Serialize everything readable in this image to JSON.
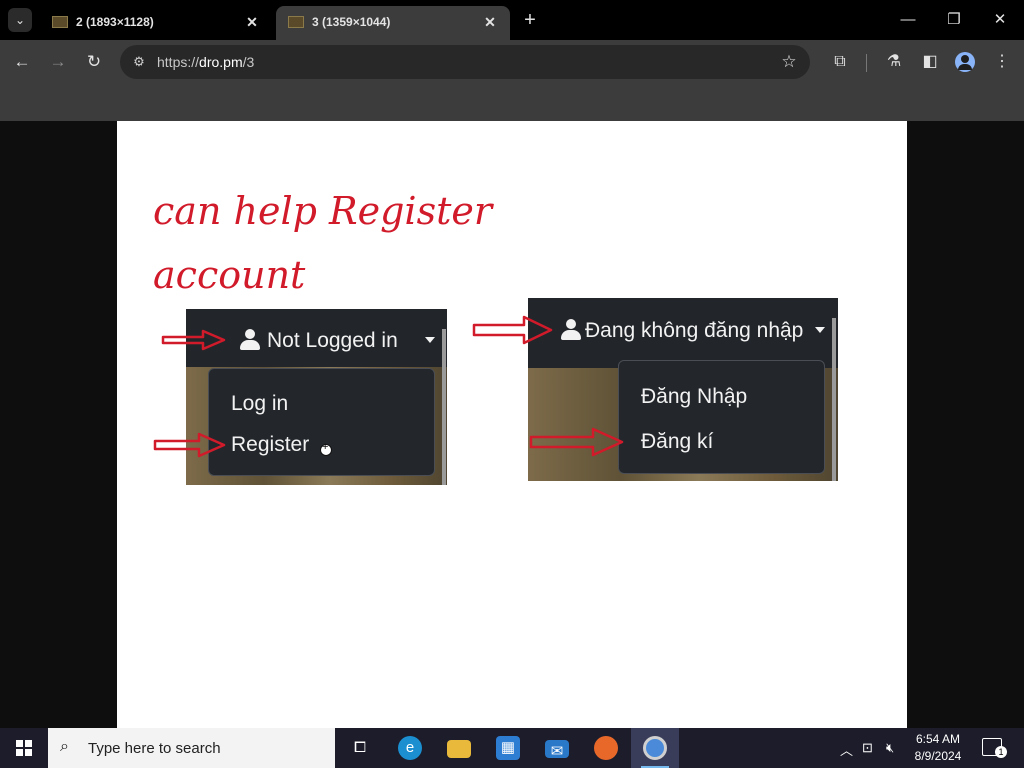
{
  "browser": {
    "tabs": [
      {
        "title": "2 (1893×1128)",
        "active": false
      },
      {
        "title": "3 (1359×1044)",
        "active": true
      }
    ],
    "url_scheme": "https://",
    "url_host": "dro.pm",
    "url_path": "/3"
  },
  "page": {
    "heading_line1": "can help Register",
    "heading_line2": "account",
    "english": {
      "status": "Not Logged in",
      "menu": [
        "Log in",
        "Register"
      ]
    },
    "vietnamese": {
      "status": "Đang không đăng nhập",
      "menu": [
        "Đăng Nhập",
        "Đăng kí"
      ]
    },
    "annotation_color": "#d11a2a"
  },
  "taskbar": {
    "search_placeholder": "Type here to search",
    "time": "6:54 AM",
    "date": "8/9/2024",
    "notification_count": "1"
  }
}
